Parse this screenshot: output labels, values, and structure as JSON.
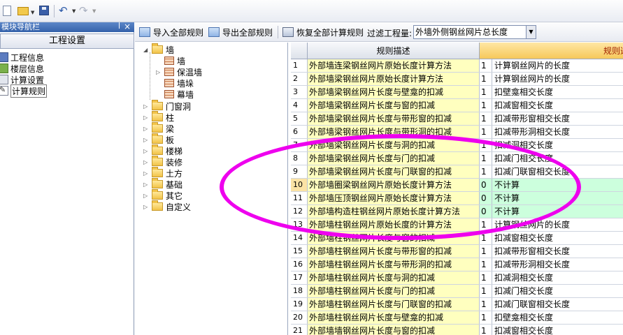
{
  "toolbar": {
    "icons": [
      "new-file-icon",
      "open-folder-icon",
      "save-icon",
      "undo-icon",
      "redo-icon"
    ]
  },
  "nav": {
    "title": "模块导航栏",
    "section": "工程设置",
    "items": [
      {
        "label": "工程信息",
        "icon": "info-icon"
      },
      {
        "label": "楼层信息",
        "icon": "floor-icon"
      },
      {
        "label": "计算设置",
        "icon": "calc-settings-icon"
      },
      {
        "label": "计算规则",
        "icon": "rule-icon",
        "selected": true
      }
    ]
  },
  "ruletoolbar": {
    "import_label": "导入全部规则",
    "export_label": "导出全部规则",
    "restore_label": "恢复全部计算规则",
    "filter_label": "过滤工程量:",
    "filter_value": "外墙外侧钢丝网片总长度"
  },
  "tree": {
    "root": "墙",
    "children": [
      "墙",
      "保温墙",
      "墙垛",
      "幕墙"
    ],
    "others": [
      "门窗洞",
      "柱",
      "梁",
      "板",
      "楼梯",
      "装修",
      "土方",
      "基础",
      "其它",
      "自定义"
    ]
  },
  "grid": {
    "col_desc": "规则描述",
    "col_rule": "规则选",
    "rows": [
      {
        "num": "1",
        "desc": "外部墙连梁钢丝网片原始长度计算方法",
        "val": "1",
        "text": "计算钢丝网片的长度"
      },
      {
        "num": "2",
        "desc": "外部墙梁钢丝网片原始长度计算方法",
        "val": "1",
        "text": "计算钢丝网片的长度"
      },
      {
        "num": "3",
        "desc": "外部墙梁钢丝网片长度与壁龛的扣减",
        "val": "1",
        "text": "扣壁龛相交长度"
      },
      {
        "num": "4",
        "desc": "外部墙梁钢丝网片长度与窗的扣减",
        "val": "1",
        "text": "扣减窗相交长度"
      },
      {
        "num": "5",
        "desc": "外部墙梁钢丝网片长度与带形窗的扣减",
        "val": "1",
        "text": "扣减带形窗相交长度"
      },
      {
        "num": "6",
        "desc": "外部墙梁钢丝网片长度与带形洞的扣减",
        "val": "1",
        "text": "扣减带形洞相交长度"
      },
      {
        "num": "7",
        "desc": "外部墙梁钢丝网片长度与洞的扣减",
        "val": "1",
        "text": "扣减洞相交长度"
      },
      {
        "num": "8",
        "desc": "外部墙梁钢丝网片长度与门的扣减",
        "val": "1",
        "text": "扣减门相交长度"
      },
      {
        "num": "9",
        "desc": "外部墙梁钢丝网片长度与门联窗的扣减",
        "val": "1",
        "text": "扣减门联窗相交长度"
      },
      {
        "num": "10",
        "desc": "外部墙圈梁钢丝网片原始长度计算方法",
        "val": "0",
        "text": "不计算",
        "hl": true,
        "cur": true
      },
      {
        "num": "11",
        "desc": "外部墙压顶钢丝网片原始长度计算方法",
        "val": "0",
        "text": "不计算",
        "hl": true
      },
      {
        "num": "12",
        "desc": "外部墙构造柱钢丝网片原始长度计算方法",
        "val": "0",
        "text": "不计算",
        "hl": true
      },
      {
        "num": "13",
        "desc": "外部墙柱钢丝网片原始长度的计算方法",
        "val": "1",
        "text": "计算钢丝网片的长度"
      },
      {
        "num": "14",
        "desc": "外部墙柱钢丝网片长度与窗的扣减",
        "val": "1",
        "text": "扣减窗相交长度"
      },
      {
        "num": "15",
        "desc": "外部墙柱钢丝网片长度与带形窗的扣减",
        "val": "1",
        "text": "扣减带形窗相交长度"
      },
      {
        "num": "16",
        "desc": "外部墙柱钢丝网片长度与带形洞的扣减",
        "val": "1",
        "text": "扣减带形洞相交长度"
      },
      {
        "num": "17",
        "desc": "外部墙柱钢丝网片长度与洞的扣减",
        "val": "1",
        "text": "扣减洞相交长度"
      },
      {
        "num": "18",
        "desc": "外部墙柱钢丝网片长度与门的扣减",
        "val": "1",
        "text": "扣减门相交长度"
      },
      {
        "num": "19",
        "desc": "外部墙柱钢丝网片长度与门联窗的扣减",
        "val": "1",
        "text": "扣减门联窗相交长度"
      },
      {
        "num": "20",
        "desc": "外部墙柱钢丝网片长度与壁龛的扣减",
        "val": "1",
        "text": "扣壁龛相交长度"
      },
      {
        "num": "21",
        "desc": "外部墙墙钢丝网片长度与窗的扣减",
        "val": "1",
        "text": "扣减窗相交长度"
      }
    ]
  },
  "colors": {
    "desc_bg": "#ffffbf",
    "highlight_bg": "#ccffdd",
    "annotation": "#ee00ee",
    "header_accent": "#f6c85a"
  }
}
